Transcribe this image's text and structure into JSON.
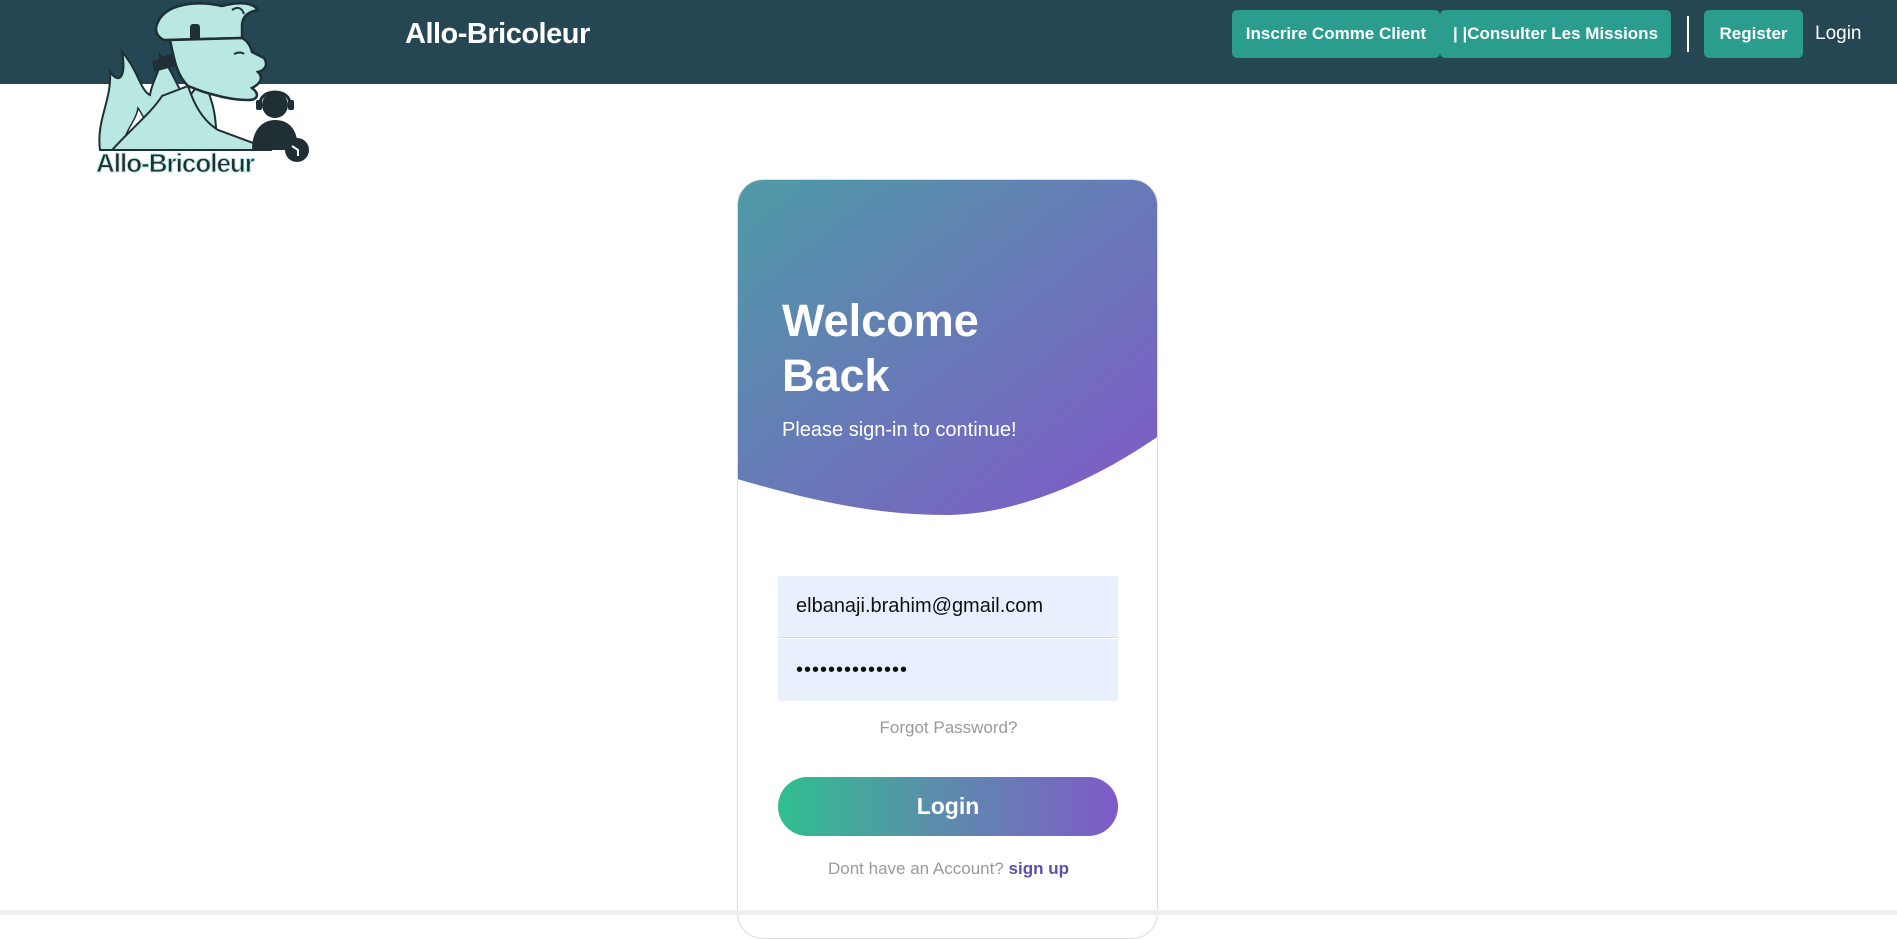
{
  "navbar": {
    "brand": "Allo-Bricoleur",
    "buttons": {
      "client": "Inscrire Comme Client",
      "missions": "| |Consulter Les Missions",
      "register": "Register"
    },
    "login_link": "Login"
  },
  "logo": {
    "text": "Allo-Bricoleur",
    "icon": "firefighter-logo"
  },
  "card": {
    "title_line1": "Welcome",
    "title_line2": "Back",
    "subtitle": "Please sign-in to continue!",
    "email": {
      "value": "elbanaji.brahim@gmail.com"
    },
    "password": {
      "value": "••••••••••••••"
    },
    "forgot": "Forgot Password?",
    "login_button": "Login",
    "no_account": "Dont have an Account?",
    "signup": "sign up"
  },
  "colors": {
    "navbar": "#254653",
    "nav_button": "#2a9d8f",
    "gradient_start": "#4e9ba6",
    "gradient_end": "#8158c8",
    "login_gradient_start": "#2fbf8e",
    "login_gradient_end": "#7f5bc9",
    "signup_link": "#5b4fb0",
    "input_bg": "#e8f0fe"
  }
}
